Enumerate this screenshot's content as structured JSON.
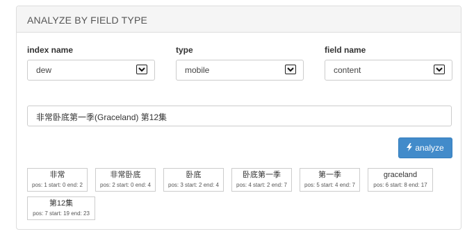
{
  "panel": {
    "title": "ANALYZE BY FIELD TYPE"
  },
  "fields": {
    "index": {
      "label": "index name",
      "value": "dew"
    },
    "type": {
      "label": "type",
      "value": "mobile"
    },
    "field": {
      "label": "field name",
      "value": "content"
    }
  },
  "query": {
    "value": "非常卧底第一季(Graceland) 第12集"
  },
  "analyze_button": {
    "label": "analyze",
    "icon": "bolt-icon",
    "color": "#428bca"
  },
  "tokens": [
    {
      "term": "非常",
      "meta": "pos: 1 start: 0 end: 2"
    },
    {
      "term": "非常卧底",
      "meta": "pos: 2 start: 0 end: 4"
    },
    {
      "term": "卧底",
      "meta": "pos: 3 start: 2 end: 4"
    },
    {
      "term": "卧底第一季",
      "meta": "pos: 4 start: 2 end: 7"
    },
    {
      "term": "第一季",
      "meta": "pos: 5 start: 4 end: 7"
    },
    {
      "term": "graceland",
      "meta": "pos: 6 start: 8 end: 17"
    },
    {
      "term": "第12集",
      "meta": "pos: 7 start: 19 end: 23"
    }
  ]
}
